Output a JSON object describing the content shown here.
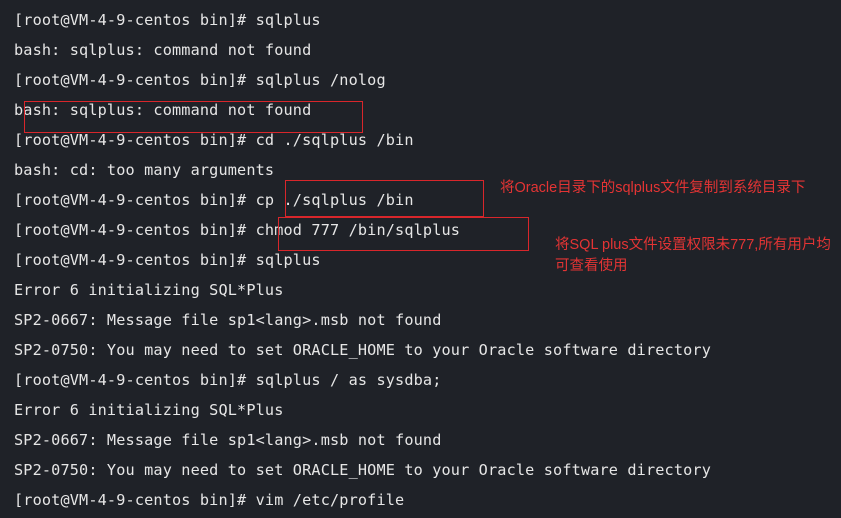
{
  "terminal": {
    "lines": [
      "[root@VM-4-9-centos bin]# sqlplus",
      "bash: sqlplus: command not found",
      "[root@VM-4-9-centos bin]# sqlplus /nolog",
      "bash: sqlplus: command not found",
      "[root@VM-4-9-centos bin]# cd ./sqlplus /bin",
      "bash: cd: too many arguments",
      "[root@VM-4-9-centos bin]# cp ./sqlplus /bin",
      "[root@VM-4-9-centos bin]# chmod 777 /bin/sqlplus",
      "[root@VM-4-9-centos bin]# sqlplus",
      "Error 6 initializing SQL*Plus",
      "SP2-0667: Message file sp1<lang>.msb not found",
      "SP2-0750: You may need to set ORACLE_HOME to your Oracle software directory",
      "[root@VM-4-9-centos bin]# sqlplus / as sysdba;",
      "Error 6 initializing SQL*Plus",
      "SP2-0667: Message file sp1<lang>.msb not found",
      "SP2-0750: You may need to set ORACLE_HOME to your Oracle software directory",
      "[root@VM-4-9-centos bin]# vim /etc/profile"
    ]
  },
  "annotations": {
    "copy_note": "将Oracle目录下的sqlplus文件复制到系统目录下",
    "chmod_note": "将SQL plus文件设置权限未777,所有用户均可查看使用"
  },
  "colors": {
    "background": "#1f2228",
    "text": "#e6e6e6",
    "highlight": "#d8262b",
    "annotation": "#e33434"
  }
}
